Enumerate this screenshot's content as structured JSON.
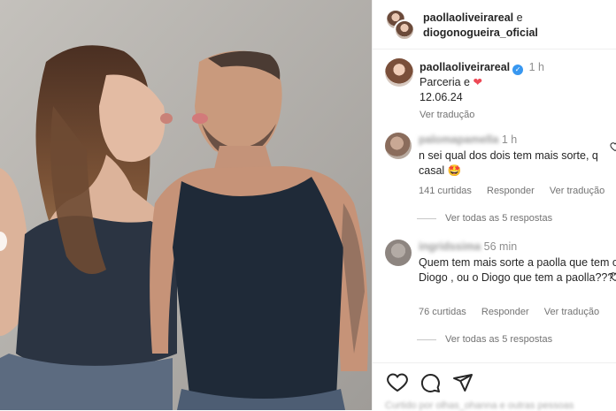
{
  "header": {
    "user1": "paollaoliveirareal",
    "conjunction": "e",
    "user2": "diogonogueira_oficial"
  },
  "caption": {
    "username": "paollaoliveirareal",
    "time": "1 h",
    "text_line1": "Parceria e",
    "heart": "❤",
    "text_line2": "12.06.24",
    "translate": "Ver tradução"
  },
  "comments": [
    {
      "username": "palomapamella",
      "time": "1 h",
      "text": "n sei qual dos dois tem mais sorte, q casal 🤩",
      "likes": "141 curtidas",
      "reply": "Responder",
      "translate": "Ver tradução",
      "view_replies": "Ver todas as 5 respostas"
    },
    {
      "username": "ingridssima",
      "time": "56 min",
      "text": "Quem tem mais sorte a paolla que tem o Diogo , ou o Diogo que tem a paolla????",
      "likes": "76 curtidas",
      "reply": "Responder",
      "translate": "Ver tradução",
      "view_replies": "Ver todas as 5 respostas"
    }
  ],
  "footer": {
    "add_comment": "Curtido por olhas_ohanna e outras pessoas"
  },
  "icons": {
    "verified": "verified-badge-icon",
    "like": "heart-outline-icon",
    "comment": "speech-bubble-icon",
    "share": "paper-plane-icon"
  },
  "colors": {
    "verified": "#3897f0",
    "heart": "#ed4956",
    "muted": "#737373",
    "text": "#262626"
  }
}
